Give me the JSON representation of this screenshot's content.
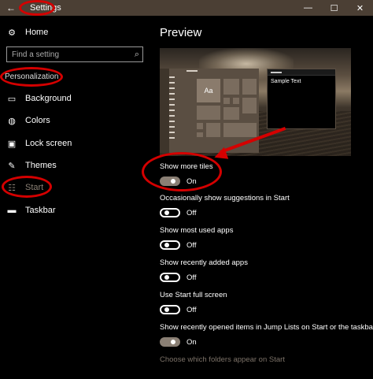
{
  "window": {
    "title": "Settings",
    "back_glyph": "←",
    "minimize_glyph": "—",
    "maximize_glyph": "☐",
    "close_glyph": "✕"
  },
  "sidebar": {
    "home": {
      "label": "Home",
      "icon": "gear-icon"
    },
    "search": {
      "placeholder": "Find a setting",
      "value": "",
      "icon": "search-icon"
    },
    "section_label": "Personalization",
    "items": [
      {
        "label": "Background",
        "icon": "picture-icon",
        "selected": false
      },
      {
        "label": "Colors",
        "icon": "palette-icon",
        "selected": false
      },
      {
        "label": "Lock screen",
        "icon": "lock-screen-icon",
        "selected": false
      },
      {
        "label": "Themes",
        "icon": "brush-icon",
        "selected": false
      },
      {
        "label": "Start",
        "icon": "start-menu-icon",
        "selected": true
      },
      {
        "label": "Taskbar",
        "icon": "taskbar-icon",
        "selected": false
      }
    ]
  },
  "main": {
    "title": "Preview",
    "preview": {
      "tile_text": "Aa",
      "sample_text": "Sample Text"
    },
    "settings": [
      {
        "label": "Show more tiles",
        "state": "On",
        "on": true
      },
      {
        "label": "Occasionally show suggestions in Start",
        "state": "Off",
        "on": false
      },
      {
        "label": "Show most used apps",
        "state": "Off",
        "on": false
      },
      {
        "label": "Show recently added apps",
        "state": "Off",
        "on": false
      },
      {
        "label": "Use Start full screen",
        "state": "Off",
        "on": false
      },
      {
        "label": "Show recently opened items in Jump Lists on Start or the taskbar",
        "state": "On",
        "on": true
      }
    ],
    "link": "Choose which folders appear on Start"
  },
  "colors": {
    "accent": "#8a7f74",
    "titlebar": "#4b3f34",
    "annotation": "#d40000"
  }
}
